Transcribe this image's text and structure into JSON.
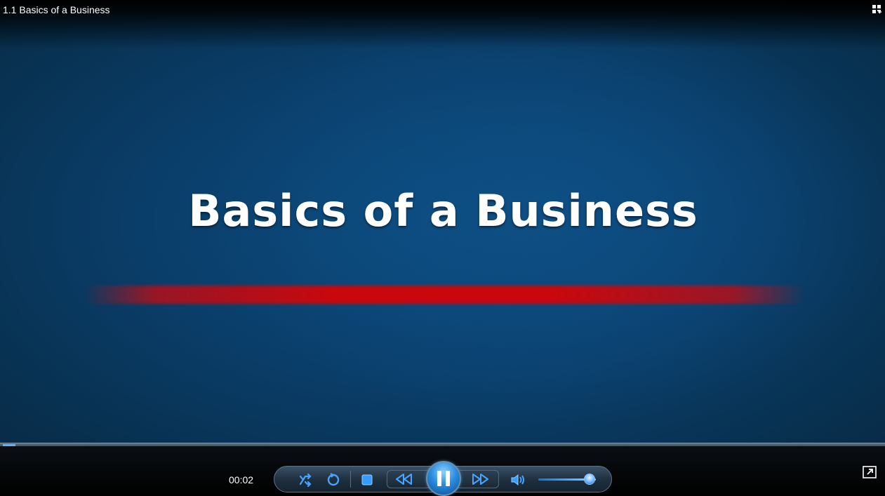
{
  "window": {
    "title": "1.1 Basics of a Business",
    "layout_button_icon": "switch-to-library-icon"
  },
  "video": {
    "headline": "Basics of a Business",
    "accent_line_color": "#c8080c",
    "background_color": "#0a3e6a"
  },
  "player": {
    "elapsed_time": "00:02",
    "seek_progress": 0.015,
    "volume_level": 0.9,
    "state": "playing",
    "controls": {
      "shuffle_icon": "shuffle-icon",
      "repeat_icon": "repeat-icon",
      "stop_icon": "stop-icon",
      "previous_icon": "previous-icon",
      "pause_icon": "pause-icon",
      "next_icon": "next-icon",
      "mute_icon": "speaker-icon",
      "fullscreen_icon": "fullscreen-icon"
    }
  }
}
